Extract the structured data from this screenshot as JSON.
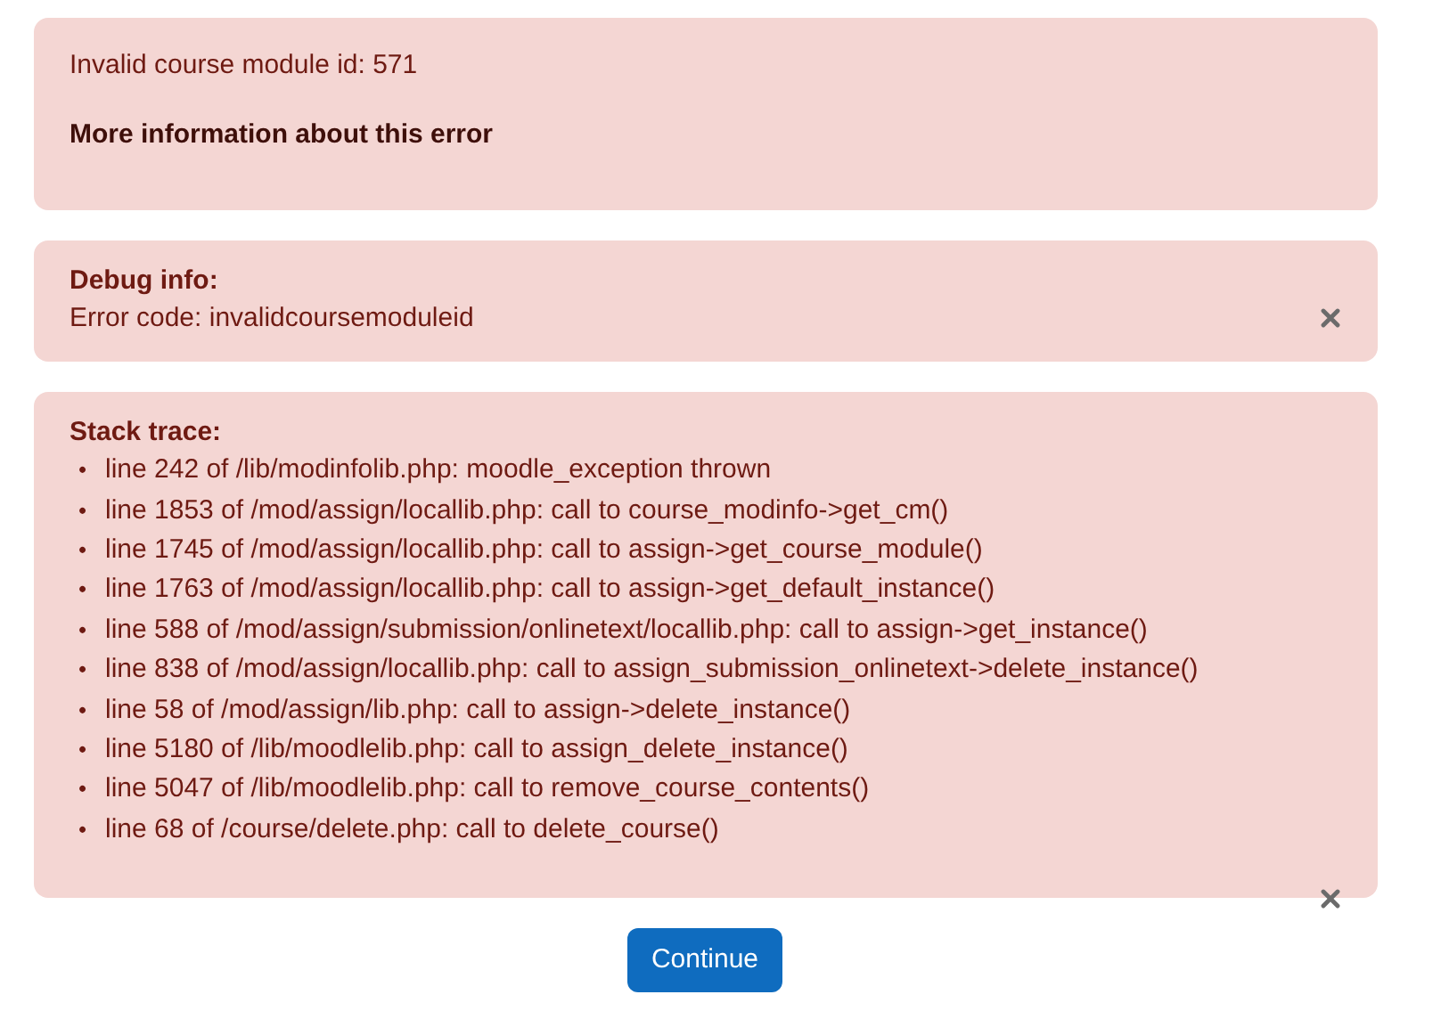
{
  "error_box": {
    "message": "Invalid course module id: 571",
    "more_info_link": "More information about this error"
  },
  "debug_box": {
    "heading": "Debug info:",
    "error_code": "Error code: invalidcoursemoduleid"
  },
  "stack_trace_box": {
    "heading": "Stack trace:",
    "bullet": "•",
    "lines": [
      "line 242 of /lib/modinfolib.php: moodle_exception thrown",
      "line 1853 of /mod/assign/locallib.php: call to course_modinfo->get_cm()",
      "line 1745 of /mod/assign/locallib.php: call to assign->get_course_module()",
      "line 1763 of /mod/assign/locallib.php: call to assign->get_default_instance()",
      "line 588 of /mod/assign/submission/onlinetext/locallib.php: call to assign->get_instance()",
      "line 838 of /mod/assign/locallib.php: call to assign_submission_onlinetext->delete_instance()",
      "line 58 of /mod/assign/lib.php: call to assign->delete_instance()",
      "line 5180 of /lib/moodlelib.php: call to assign_delete_instance()",
      "line 5047 of /lib/moodlelib.php: call to remove_course_contents()",
      "line 68 of /course/delete.php: call to delete_course()"
    ]
  },
  "continue_button": "Continue"
}
